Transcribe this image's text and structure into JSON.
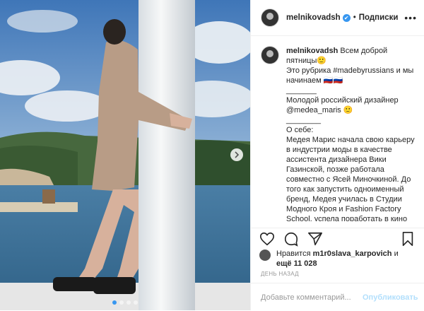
{
  "post": {
    "username": "melnikovadsh",
    "verified_mark": "✔",
    "separator": "•",
    "follow_label": "Подписки",
    "more_label": "•••",
    "caption": {
      "username": "melnikovadsh",
      "text": " Всем доброй пятницы🙂\nЭто рубрика #madebyrussians и мы начинаем 🇷🇺🇷🇺\n_______\nМолодой российский дизайнер\n@medea_maris 🙂\n________\nО себе:\nМедея Марис начала свою карьеру в индустрии моды в качестве ассистента дизайнера Вики Газинской, позже работала совместно с Ясей Миночкиной. До того как запустить одноименный бренд, Медея училась в Студии Модного Кроя и Fashion Factory School, успела поработать в кино художником по костюмам,  V.I.P"
    },
    "likes": {
      "prefix": "Нравится",
      "user": "m1r0slava_karpovich",
      "conjunction": "и",
      "more": "ещё 11 028"
    },
    "time_label": "ДЕНЬ НАЗАД",
    "comment": {
      "placeholder": "Добавьте комментарий...",
      "value": "",
      "publish_label": "Опубликовать"
    },
    "icons": {
      "like": "heart-icon",
      "comment": "comment-icon",
      "share": "share-icon",
      "save": "bookmark-icon",
      "next": "chevron-right-icon"
    },
    "carousel": {
      "count": 4,
      "active": 1
    },
    "colors": {
      "link": "#003569",
      "accent": "#3897f0",
      "publish": "#b2dffc"
    }
  }
}
